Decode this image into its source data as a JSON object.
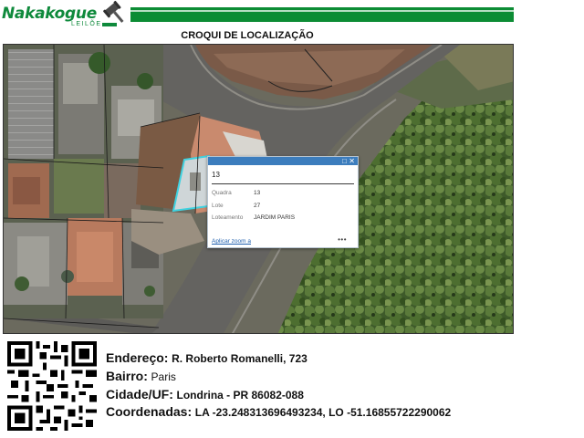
{
  "header": {
    "brand_name": "Nakakogue",
    "brand_sub": "LEILÕES",
    "logo_icon": "gavel-icon",
    "bar_color": "#0c8c34"
  },
  "title": "CROQUI DE LOCALIZAÇÃO",
  "popup": {
    "title": "13",
    "fields": [
      {
        "label": "Quadra",
        "value": "13"
      },
      {
        "label": "Lote",
        "value": "27"
      },
      {
        "label": "Loteamento",
        "value": "JARDIM PARIS"
      }
    ],
    "zoom_link": "Aplicar zoom a",
    "more": "•••",
    "maximize_icon": "maximize-icon",
    "close_icon": "close-icon",
    "header_color": "#3c7dbd"
  },
  "address": {
    "endereco_label": "Endereço:",
    "endereco_value": "R. Roberto Romanelli, 723",
    "bairro_label": "Bairro:",
    "bairro_value": "Paris",
    "cidade_label": "Cidade/UF:",
    "cidade_value": "Londrina - PR 86082-088",
    "coord_label": "Coordenadas:",
    "coord_value": "LA -23.248313696493234, LO -51.16855722290062"
  },
  "qr_icon": "qr-code-icon",
  "highlight_color": "#3fd2e0"
}
